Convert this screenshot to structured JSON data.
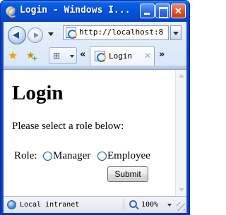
{
  "window": {
    "title": "Login - Windows I..."
  },
  "toolbar": {
    "address": "http://localhost:8",
    "tab_label": "Login",
    "tab_close": "✕",
    "tab_scroll_left": "«",
    "tab_scroll_right": "»",
    "quick_tabs_glyph": "⊞"
  },
  "icons": {
    "back": "back-arrow-icon",
    "forward": "forward-arrow-icon",
    "favorites": "star-icon",
    "add_favorites": "add-favorite-icon",
    "page": "ie-page-icon",
    "zone": "globe-icon",
    "zoom": "magnifier-icon"
  },
  "page": {
    "heading": "Login",
    "instruction": "Please select a role below:",
    "role_label": "Role:",
    "roles": [
      "Manager",
      "Employee"
    ],
    "submit_label": "Submit"
  },
  "status": {
    "zone": "Local intranet",
    "zoom": "100%"
  },
  "colors": {
    "titlebar": "#0553d9",
    "chrome": "#d8e6f8",
    "close_button": "#dd4f22"
  }
}
